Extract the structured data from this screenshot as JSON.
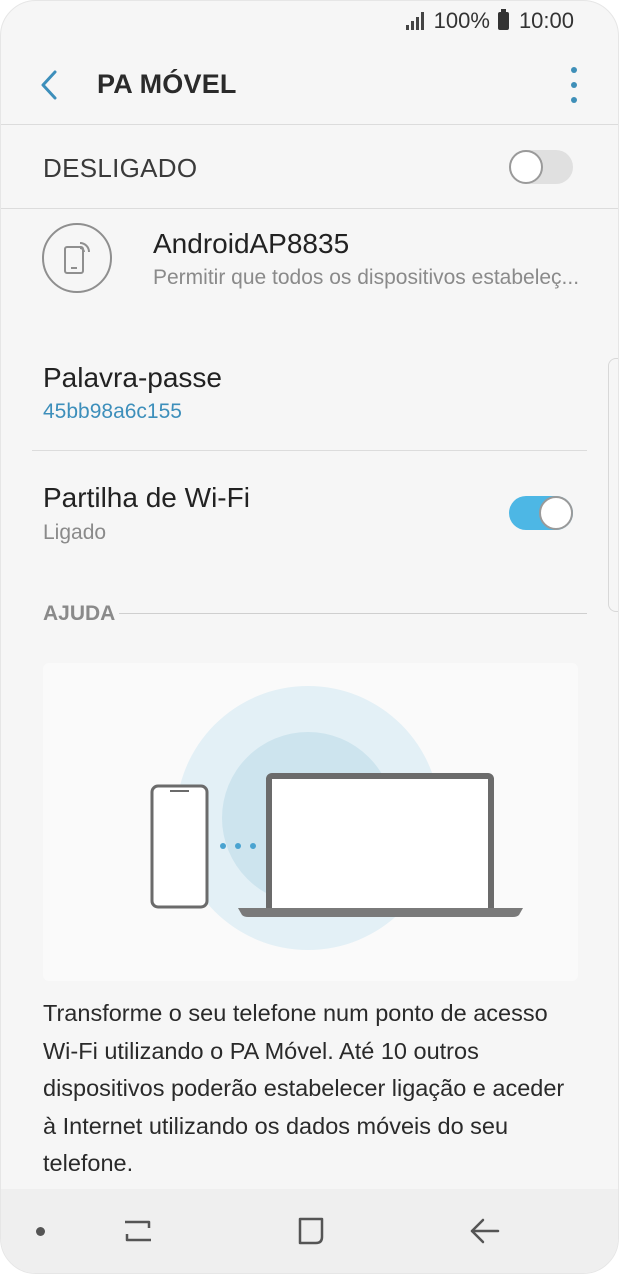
{
  "status_bar": {
    "battery": "100%",
    "time": "10:00"
  },
  "header": {
    "title": "PA MÓVEL"
  },
  "master_switch": {
    "label": "DESLIGADO",
    "state": "off"
  },
  "network": {
    "name": "AndroidAP8835",
    "description": "Permitir que todos os dispositivos estabeleç..."
  },
  "password": {
    "label": "Palavra-passe",
    "value": "45bb98a6c155"
  },
  "wifi_sharing": {
    "label": "Partilha de Wi-Fi",
    "status": "Ligado",
    "state": "on"
  },
  "help": {
    "heading": "AJUDA",
    "text": "Transforme o seu telefone num ponto de acesso Wi-Fi utilizando o PA Móvel. Até 10 outros dispositivos poderão estabelecer ligação e aceder à Internet utilizando os dados móveis do seu telefone."
  },
  "colors": {
    "accent": "#3d8fbb",
    "toggle_on": "#4db7e5",
    "circle_outer": "#e3f0f6",
    "circle_inner": "#cde4ee"
  },
  "icons": [
    "signal-icon",
    "battery-icon",
    "back-icon",
    "more-options-icon",
    "hotspot-device-icon",
    "phone-icon",
    "laptop-icon",
    "recents-icon",
    "home-icon",
    "back-nav-icon"
  ]
}
